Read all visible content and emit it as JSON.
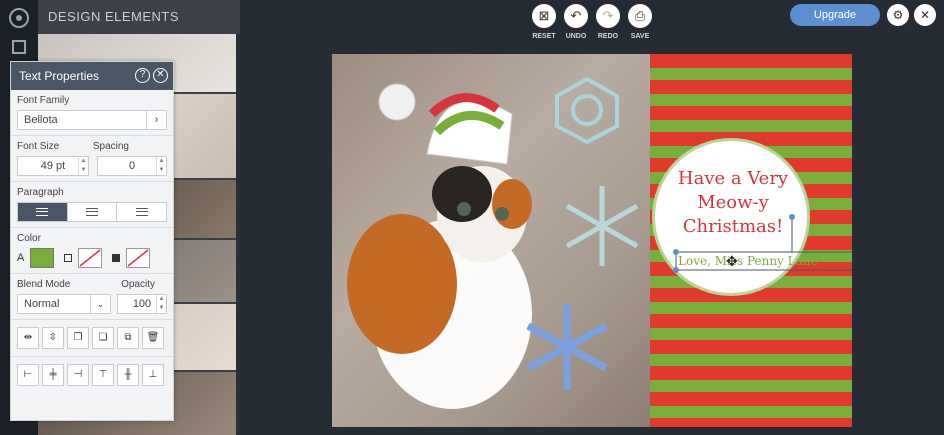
{
  "sidebar": {
    "title": "DESIGN ELEMENTS"
  },
  "toolbar": {
    "reset": "RESET",
    "undo": "UNDO",
    "redo": "REDO",
    "save": "SAVE",
    "upgrade": "Upgrade",
    "icons": {
      "reset": "reset-icon",
      "undo": "undo-icon",
      "redo": "redo-icon",
      "save": "save-icon",
      "settings": "gear-icon",
      "close": "close-icon"
    }
  },
  "text_properties": {
    "title": "Text Properties",
    "font_family_label": "Font Family",
    "font_family_value": "Bellota",
    "font_size_label": "Font Size",
    "font_size_value": "49 pt",
    "spacing_label": "Spacing",
    "spacing_value": "0",
    "paragraph_label": "Paragraph",
    "color_label": "Color",
    "color_text_value": "A",
    "color_swatch": "#7aae3b",
    "blend_mode_label": "Blend Mode",
    "blend_mode_value": "Normal",
    "opacity_label": "Opacity",
    "opacity_value": "100"
  },
  "canvas": {
    "greeting": "Have a Very Meow-y Christmas!",
    "signature": "Love, Miss Penny Lane",
    "stripe_colors": [
      "#e03a2d",
      "#7aae3b"
    ]
  }
}
